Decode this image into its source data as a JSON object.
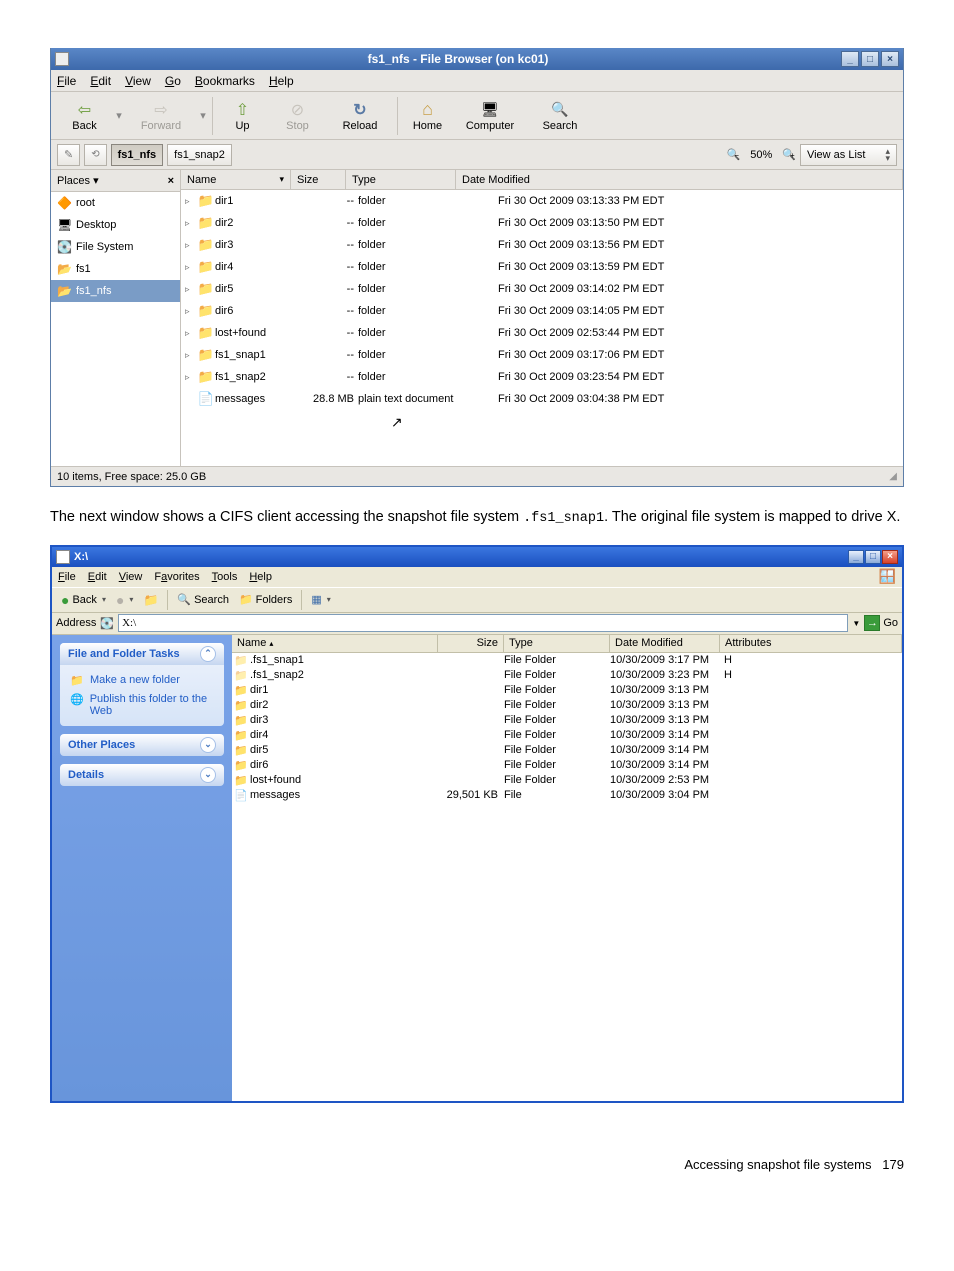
{
  "gnome": {
    "title": "fs1_nfs - File Browser (on kc01)",
    "menu": [
      "File",
      "Edit",
      "View",
      "Go",
      "Bookmarks",
      "Help"
    ],
    "toolbar": {
      "back": "Back",
      "forward": "Forward",
      "up": "Up",
      "stop": "Stop",
      "reload": "Reload",
      "home": "Home",
      "computer": "Computer",
      "search": "Search"
    },
    "breadcrumb": {
      "current": "fs1_nfs",
      "child": "fs1_snap2"
    },
    "zoom": "50%",
    "viewas": "View as List",
    "places_header": "Places",
    "places": [
      {
        "icon": "🔶",
        "label": "root"
      },
      {
        "icon": "🖥",
        "label": "Desktop"
      },
      {
        "icon": "💽",
        "label": "File System"
      },
      {
        "icon": "📂",
        "label": "fs1"
      },
      {
        "icon": "📂",
        "label": "fs1_nfs",
        "selected": true
      }
    ],
    "columns": {
      "name": "Name",
      "size": "Size",
      "type": "Type",
      "date": "Date Modified"
    },
    "rows": [
      {
        "exp": "▹",
        "icon": "folder",
        "name": "dir1",
        "size": "--",
        "type": "folder",
        "date": "Fri 30 Oct 2009 03:13:33 PM EDT"
      },
      {
        "exp": "▹",
        "icon": "folder",
        "name": "dir2",
        "size": "--",
        "type": "folder",
        "date": "Fri 30 Oct 2009 03:13:50 PM EDT"
      },
      {
        "exp": "▹",
        "icon": "folder",
        "name": "dir3",
        "size": "--",
        "type": "folder",
        "date": "Fri 30 Oct 2009 03:13:56 PM EDT"
      },
      {
        "exp": "▹",
        "icon": "folder",
        "name": "dir4",
        "size": "--",
        "type": "folder",
        "date": "Fri 30 Oct 2009 03:13:59 PM EDT"
      },
      {
        "exp": "▹",
        "icon": "folder",
        "name": "dir5",
        "size": "--",
        "type": "folder",
        "date": "Fri 30 Oct 2009 03:14:02 PM EDT"
      },
      {
        "exp": "▹",
        "icon": "folder",
        "name": "dir6",
        "size": "--",
        "type": "folder",
        "date": "Fri 30 Oct 2009 03:14:05 PM EDT"
      },
      {
        "exp": "▹",
        "icon": "folder",
        "name": "lost+found",
        "size": "--",
        "type": "folder",
        "date": "Fri 30 Oct 2009 02:53:44 PM EDT"
      },
      {
        "exp": "▹",
        "icon": "folder",
        "name": "fs1_snap1",
        "size": "--",
        "type": "folder",
        "date": "Fri 30 Oct 2009 03:17:06 PM EDT"
      },
      {
        "exp": "▹",
        "icon": "folder",
        "name": "fs1_snap2",
        "size": "--",
        "type": "folder",
        "date": "Fri 30 Oct 2009 03:23:54 PM EDT"
      },
      {
        "exp": "",
        "icon": "file",
        "name": "messages",
        "size": "28.8 MB",
        "type": "plain text document",
        "date": "Fri 30 Oct 2009 03:04:38 PM EDT"
      }
    ],
    "status": "10 items, Free space: 25.0 GB"
  },
  "caption": {
    "pre": "The next window shows a CIFS client accessing the snapshot file system ",
    "code": ".fs1_snap1",
    "post": ". The original file system is mapped to drive X."
  },
  "xp": {
    "title": "X:\\",
    "menu": [
      "File",
      "Edit",
      "View",
      "Favorites",
      "Tools",
      "Help"
    ],
    "toolbar": {
      "back": "Back",
      "search": "Search",
      "folders": "Folders"
    },
    "addr_label": "Address",
    "addr_value": "X:\\",
    "go": "Go",
    "panels": {
      "tasks_h": "File and Folder Tasks",
      "tasks": [
        {
          "icon": "📁",
          "label": "Make a new folder"
        },
        {
          "icon": "🌐",
          "label": "Publish this folder to the Web"
        }
      ],
      "other_h": "Other Places",
      "details_h": "Details"
    },
    "columns": {
      "name": "Name",
      "size": "Size",
      "type": "Type",
      "date": "Date Modified",
      "attr": "Attributes"
    },
    "rows": [
      {
        "icon": "hfolder",
        "name": ".fs1_snap1",
        "size": "",
        "type": "File Folder",
        "date": "10/30/2009 3:17 PM",
        "attr": "H"
      },
      {
        "icon": "hfolder",
        "name": ".fs1_snap2",
        "size": "",
        "type": "File Folder",
        "date": "10/30/2009 3:23 PM",
        "attr": "H"
      },
      {
        "icon": "folder",
        "name": "dir1",
        "size": "",
        "type": "File Folder",
        "date": "10/30/2009 3:13 PM",
        "attr": ""
      },
      {
        "icon": "folder",
        "name": "dir2",
        "size": "",
        "type": "File Folder",
        "date": "10/30/2009 3:13 PM",
        "attr": ""
      },
      {
        "icon": "folder",
        "name": "dir3",
        "size": "",
        "type": "File Folder",
        "date": "10/30/2009 3:13 PM",
        "attr": ""
      },
      {
        "icon": "folder",
        "name": "dir4",
        "size": "",
        "type": "File Folder",
        "date": "10/30/2009 3:14 PM",
        "attr": ""
      },
      {
        "icon": "folder",
        "name": "dir5",
        "size": "",
        "type": "File Folder",
        "date": "10/30/2009 3:14 PM",
        "attr": ""
      },
      {
        "icon": "folder",
        "name": "dir6",
        "size": "",
        "type": "File Folder",
        "date": "10/30/2009 3:14 PM",
        "attr": ""
      },
      {
        "icon": "folder",
        "name": "lost+found",
        "size": "",
        "type": "File Folder",
        "date": "10/30/2009 2:53 PM",
        "attr": ""
      },
      {
        "icon": "file",
        "name": "messages",
        "size": "29,501 KB",
        "type": "File",
        "date": "10/30/2009 3:04 PM",
        "attr": ""
      }
    ]
  },
  "footer": {
    "text": "Accessing snapshot file systems",
    "page": "179"
  }
}
